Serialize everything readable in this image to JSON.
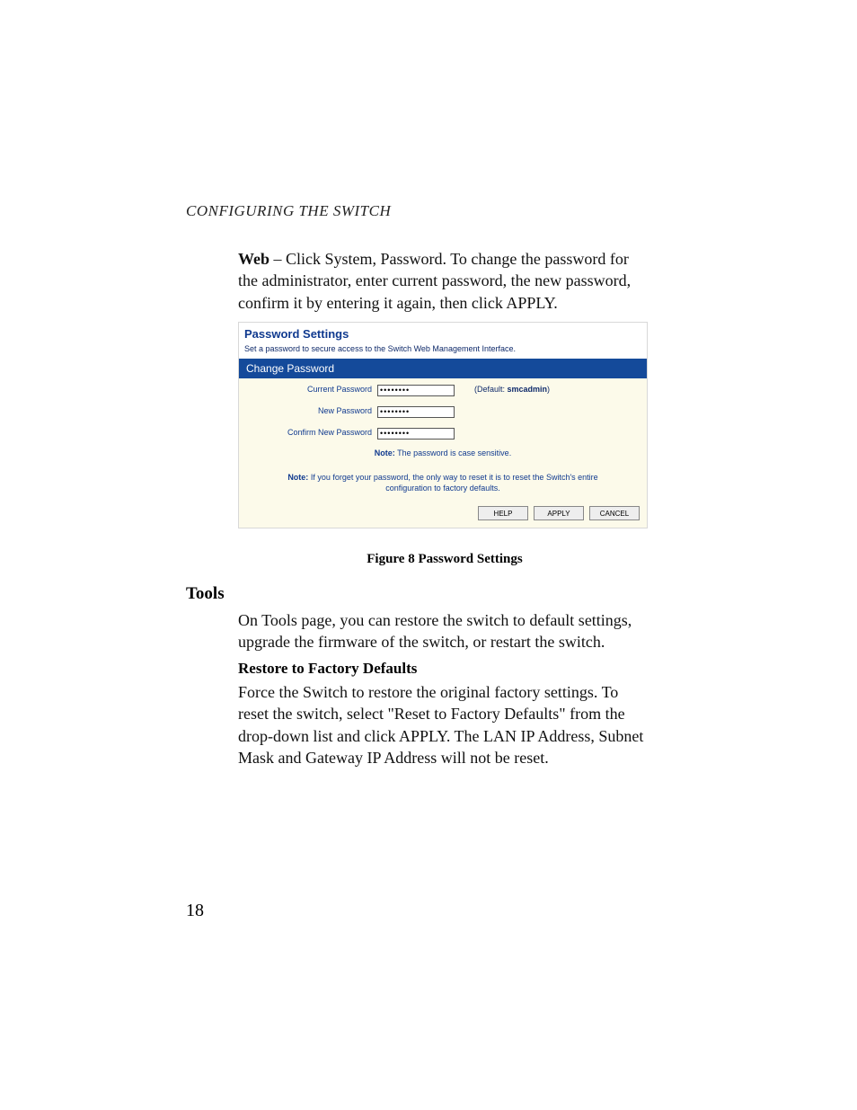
{
  "running_head": "CONFIGURING THE SWITCH",
  "para1_lead": "Web",
  "para1_rest": " – Click System, Password. To change the password for the administrator, enter current password, the new password, confirm it by entering it again, then click APPLY.",
  "screenshot": {
    "title": "Password Settings",
    "subtitle": "Set a password to secure access to the Switch Web Management Interface.",
    "section_header": "Change Password",
    "rows": {
      "current": {
        "label": "Current Password",
        "value": "********"
      },
      "newp": {
        "label": "New Password",
        "value": "********"
      },
      "confirm": {
        "label": "Confirm New Password",
        "value": "********"
      }
    },
    "default_hint_prefix": "(Default: ",
    "default_hint_value": "smcadmin",
    "default_hint_suffix": ")",
    "note1_label": "Note:",
    "note1_text": " The password is case sensitive.",
    "note2_label": "Note:",
    "note2_text": " If you forget your password, the only way to reset it is to reset the Switch's entire configuration to factory defaults.",
    "buttons": {
      "help": "HELP",
      "apply": "APPLY",
      "cancel": "CANCEL"
    }
  },
  "figure_caption": "Figure 8  Password Settings",
  "tools_heading": "Tools",
  "para2": "On Tools page, you can restore the switch to default settings, upgrade the firmware of the switch, or restart the switch.",
  "subheading": "Restore to Factory Defaults",
  "para3": "Force the Switch to  restore the original factory settings.  To reset the switch, select \"Reset to Factory Defaults\" from the drop-down list and click APPLY. The LAN IP Address, Subnet Mask and Gateway IP Address will not be reset.",
  "page_number": "18"
}
